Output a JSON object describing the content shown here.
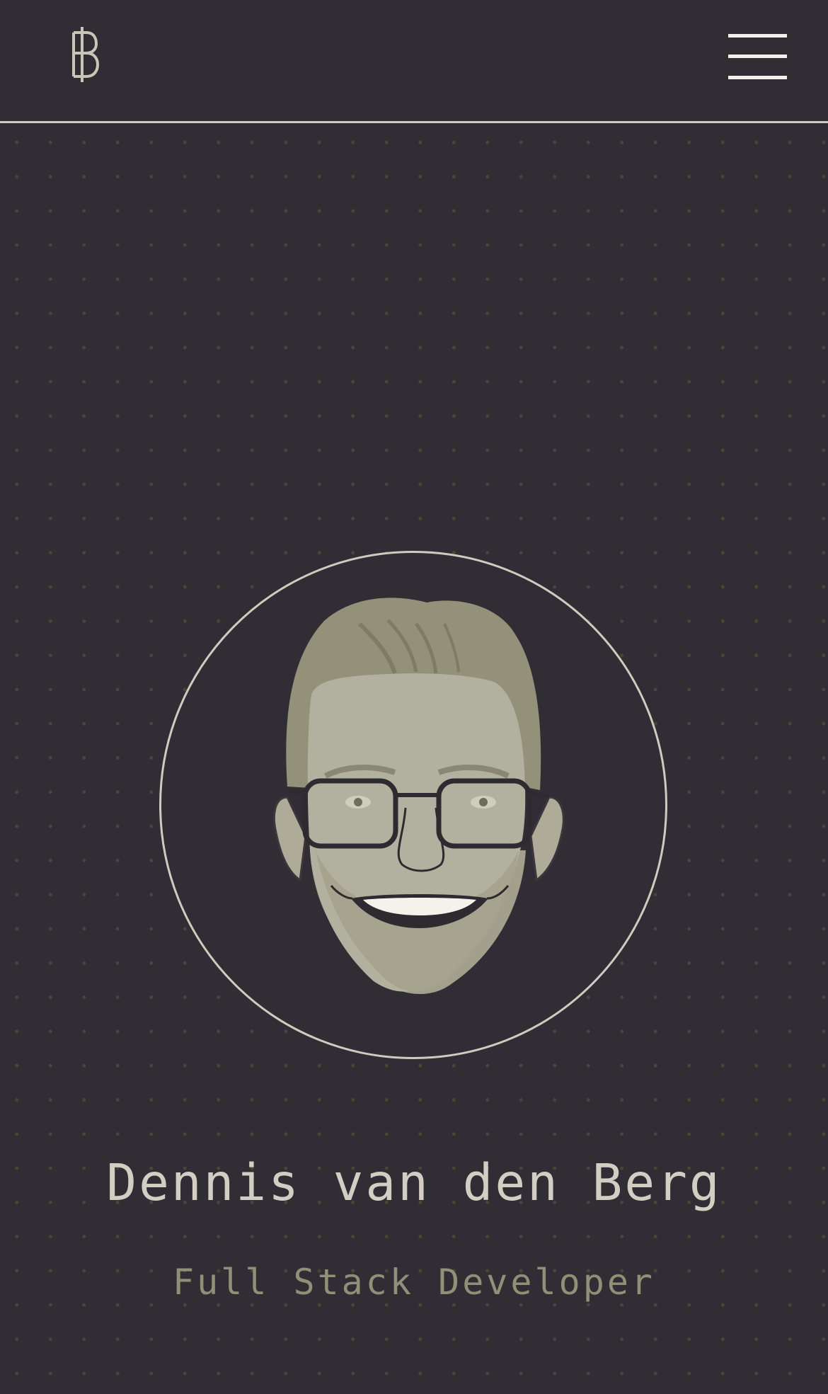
{
  "header": {
    "logo_icon": "baht-sign-logo-icon",
    "menu_icon": "hamburger-menu-icon"
  },
  "profile": {
    "avatar_icon": "illustrated-portrait-avatar",
    "name": "Dennis van den Berg",
    "role": "Full Stack Developer"
  },
  "colors": {
    "background": "#312d35",
    "rule": "#cfcbbf",
    "name_text": "#d2cec4",
    "role_text": "#928f78",
    "skin": "#b2b09e",
    "hair": "#939179",
    "dot_pattern": "#4a4536"
  }
}
